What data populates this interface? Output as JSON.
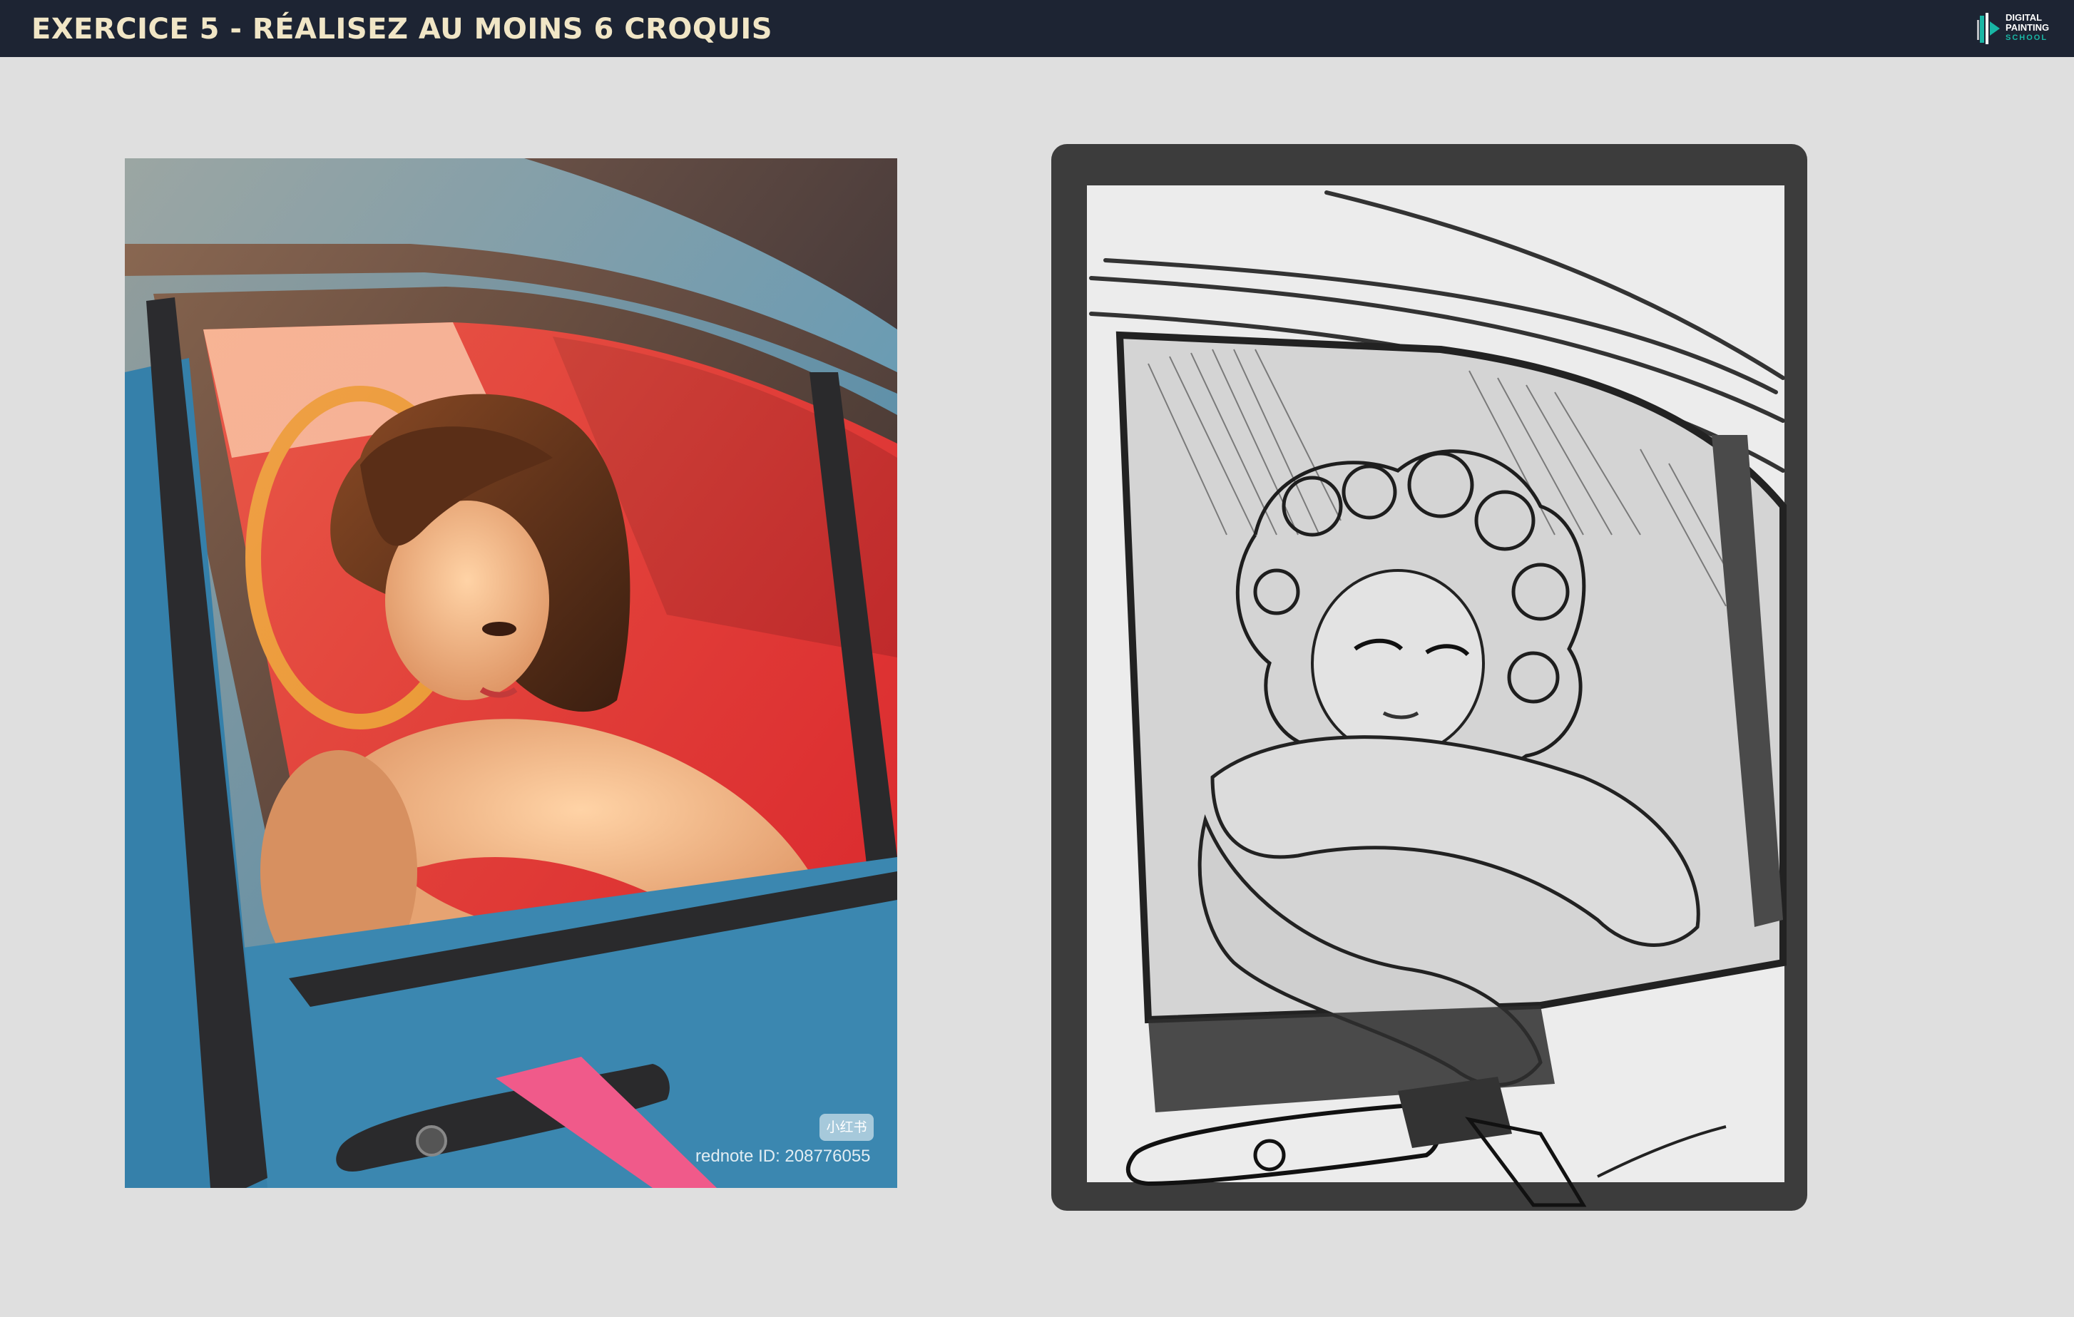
{
  "header": {
    "title": "EXERCICE 5 - RÉALISEZ AU MOINS 6 CROQUIS",
    "logo": {
      "line1": "DIGITAL",
      "line2": "PAINTING",
      "line3": "SCHOOL",
      "icon": "brush-logo-icon"
    }
  },
  "reference_photo": {
    "watermark_badge": "小红书",
    "watermark_id": "rednote ID: 208776055"
  },
  "colors": {
    "header_bg": "#1d2433",
    "title_color": "#f1e6c6",
    "logo_accent": "#19b6a5",
    "canvas_bg": "#dfdfdf",
    "car_blue": "#3f8fb7",
    "seat_red": "#e0282e"
  }
}
